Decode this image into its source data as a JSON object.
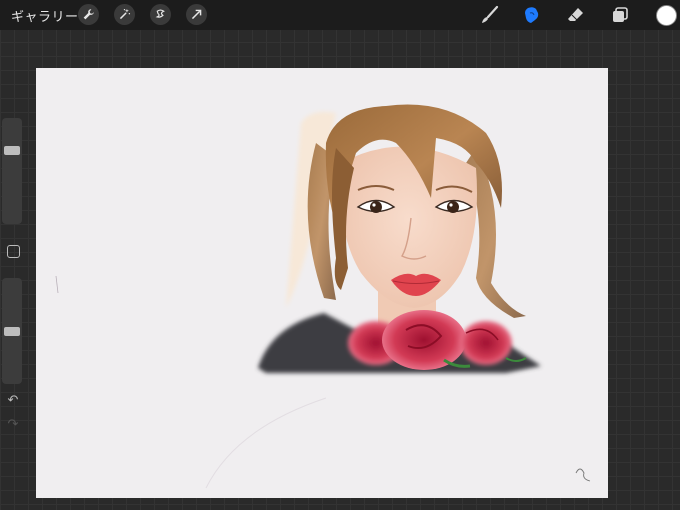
{
  "toolbar": {
    "gallery_label": "ギャラリー",
    "left_tools": [
      "wrench-icon",
      "magic-wand-icon",
      "selection-icon",
      "transform-icon"
    ],
    "right_tools": [
      "brush-icon",
      "smudge-icon",
      "eraser-icon",
      "layers-icon"
    ],
    "active_tool": "smudge-icon",
    "active_color": "#ffffff",
    "accent_color": "#1e7bff"
  },
  "sidebar": {
    "size_slider_level": 0.72,
    "opacity_slider_level": 0.5,
    "undo_icon": "undo-icon",
    "redo_icon": "redo-icon"
  }
}
